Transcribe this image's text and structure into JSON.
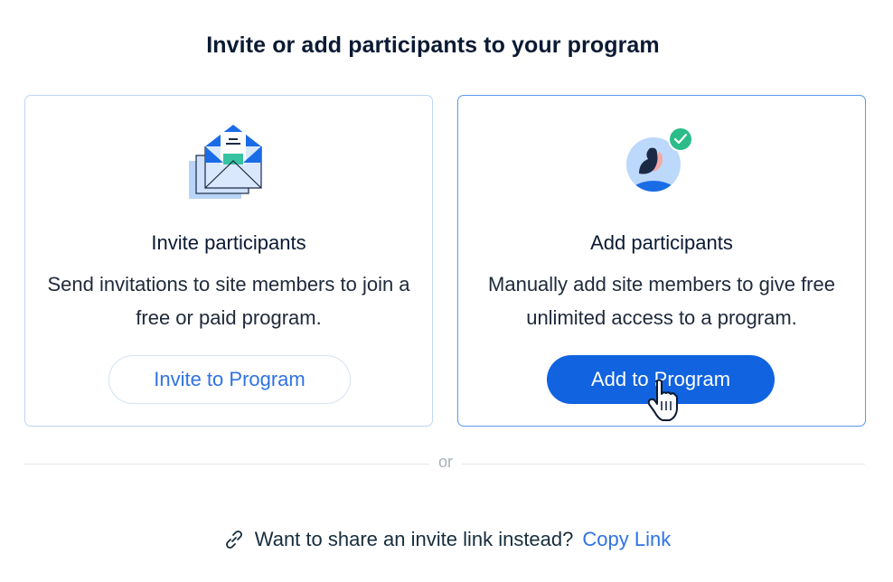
{
  "title": "Invite or add participants to your program",
  "invite_card": {
    "heading": "Invite participants",
    "description": "Send invitations to site members to join a free or paid program.",
    "button_label": "Invite to Program"
  },
  "add_card": {
    "heading": "Add participants",
    "description": "Manually add site members to give free unlimited access to a program.",
    "button_label": "Add to Program"
  },
  "divider": {
    "label": "or"
  },
  "footer": {
    "text": "Want to share an invite link instead?",
    "link_label": "Copy Link"
  },
  "colors": {
    "primary": "#1163e0",
    "link": "#2f73e3",
    "success": "#2bbc8a"
  }
}
